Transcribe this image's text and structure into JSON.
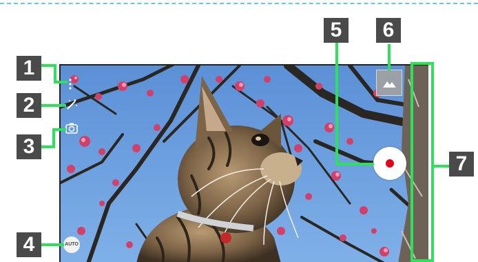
{
  "callouts": [
    "1",
    "2",
    "3",
    "4",
    "5",
    "6",
    "7"
  ],
  "controls": {
    "auto_label": "AUTO"
  },
  "icons": {
    "menu": "more-vert-icon",
    "effect": "magic-wand-icon",
    "switch_camera": "camera-switch-icon",
    "gallery": "image-thumbnail-icon",
    "shutter": "record-button-icon"
  },
  "colors": {
    "callout_bg": "#4a4a4a",
    "leader_line": "#2ee05a",
    "record_dot": "#e0001b",
    "divider": "#62c6ef"
  }
}
